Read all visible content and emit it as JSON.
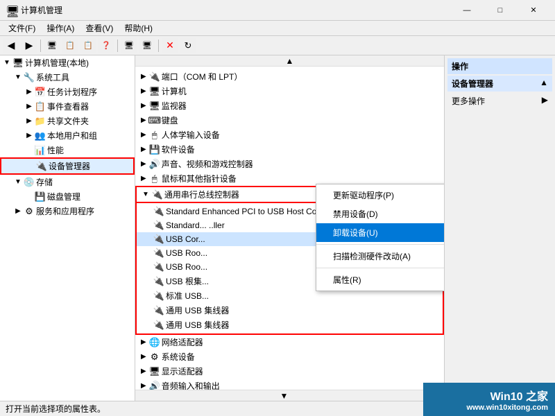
{
  "window": {
    "title": "计算机管理",
    "controls": {
      "minimize": "—",
      "maximize": "□",
      "close": "✕"
    }
  },
  "menu": {
    "items": [
      "文件(F)",
      "操作(A)",
      "查看(V)",
      "帮助(H)"
    ]
  },
  "left_tree": {
    "root": "计算机管理(本地)",
    "items": [
      {
        "label": "系统工具",
        "type": "folder",
        "expanded": true,
        "indent": 1
      },
      {
        "label": "任务计划程序",
        "type": "item",
        "indent": 2
      },
      {
        "label": "事件查看器",
        "type": "item",
        "indent": 2
      },
      {
        "label": "共享文件夹",
        "type": "item",
        "indent": 2
      },
      {
        "label": "本地用户和组",
        "type": "item",
        "indent": 2
      },
      {
        "label": "性能",
        "type": "item",
        "indent": 2
      },
      {
        "label": "设备管理器",
        "type": "item",
        "indent": 2,
        "selected": true,
        "highlighted": true
      },
      {
        "label": "存储",
        "type": "folder",
        "expanded": true,
        "indent": 1
      },
      {
        "label": "磁盘管理",
        "type": "item",
        "indent": 2
      },
      {
        "label": "服务和应用程序",
        "type": "item",
        "indent": 1
      }
    ]
  },
  "device_tree": {
    "items": [
      {
        "label": "端口（COM 和 LPT）",
        "icon": "🔌",
        "indent": 0,
        "expanded": false
      },
      {
        "label": "计算机",
        "icon": "🖥",
        "indent": 0,
        "expanded": false
      },
      {
        "label": "监视器",
        "icon": "🖥",
        "indent": 0,
        "expanded": false
      },
      {
        "label": "键盘",
        "icon": "⌨",
        "indent": 0,
        "expanded": false
      },
      {
        "label": "人体学输入设备",
        "icon": "🖱",
        "indent": 0,
        "expanded": false
      },
      {
        "label": "软件设备",
        "icon": "💾",
        "indent": 0,
        "expanded": false
      },
      {
        "label": "声音、视频和游戏控制器",
        "icon": "🔊",
        "indent": 0,
        "expanded": false
      },
      {
        "label": "鼠标和其他指针设备",
        "icon": "🖱",
        "indent": 0,
        "expanded": false
      },
      {
        "label": "通用串行总线控制器",
        "icon": "🔌",
        "indent": 0,
        "expanded": true,
        "highlighted": true
      },
      {
        "label": "Standard Enhanced PCI to USB Host Controller",
        "icon": "🔌",
        "indent": 1
      },
      {
        "label": "Standard...",
        "icon": "🔌",
        "indent": 1,
        "truncated": true
      },
      {
        "label": "USB Cor...",
        "icon": "🔌",
        "indent": 1
      },
      {
        "label": "USB Root...",
        "icon": "🔌",
        "indent": 1
      },
      {
        "label": "USB Root...",
        "icon": "🔌",
        "indent": 1
      },
      {
        "label": "USB 根集...",
        "icon": "🔌",
        "indent": 1
      },
      {
        "label": "标准 USB...",
        "icon": "🔌",
        "indent": 1
      },
      {
        "label": "通用 USB 集线器",
        "icon": "🔌",
        "indent": 1
      },
      {
        "label": "通用 USB 集线器",
        "icon": "🔌",
        "indent": 1
      },
      {
        "label": "网络适配器",
        "icon": "🌐",
        "indent": 0,
        "expanded": false
      },
      {
        "label": "系统设备",
        "icon": "⚙",
        "indent": 0,
        "expanded": false
      },
      {
        "label": "显示适配器",
        "icon": "🖥",
        "indent": 0,
        "expanded": false
      },
      {
        "label": "音频输入和输出",
        "icon": "🔊",
        "indent": 0,
        "expanded": false
      }
    ]
  },
  "context_menu": {
    "items": [
      {
        "label": "更新驱动程序(P)",
        "active": false
      },
      {
        "label": "禁用设备(D)",
        "active": false
      },
      {
        "label": "卸载设备(U)",
        "active": true
      },
      {
        "separator": true
      },
      {
        "label": "扫描检测硬件改动(A)",
        "active": false
      },
      {
        "separator": true
      },
      {
        "label": "属性(R)",
        "active": false
      }
    ]
  },
  "actions_panel": {
    "title": "操作",
    "section": "设备管理器",
    "items": [
      "更多操作"
    ]
  },
  "status_bar": {
    "text": "打开当前选择项的属性表。"
  },
  "watermark": {
    "line1": "Win10 之家",
    "line2": "www.win10xitong.com"
  }
}
